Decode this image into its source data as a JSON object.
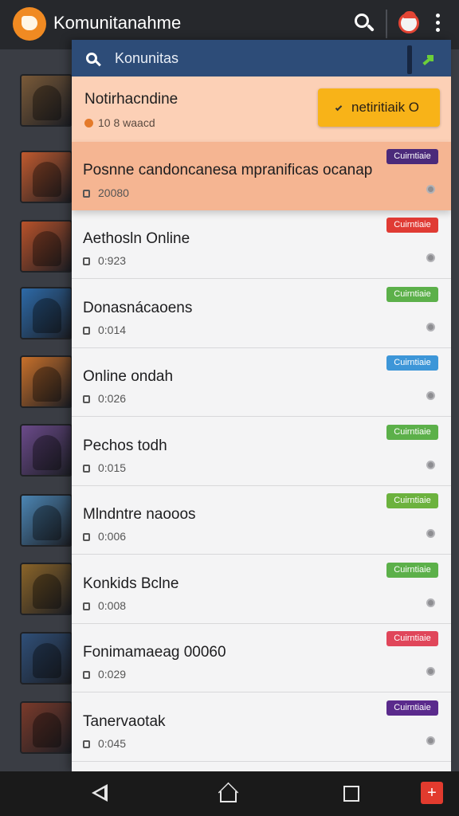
{
  "appbar": {
    "title": "Komunitanahme"
  },
  "panel": {
    "search_text": "Konunitas",
    "notification": {
      "title": "Notirhacndine",
      "meta": "10 8 waacd",
      "button_label": "netiritiaik O"
    },
    "featured": {
      "title": "Posnne candoncanesa mpranificas ocanap",
      "meta": "20080",
      "badge": "Cuirntiaie",
      "badge_color": "#4b2a7a"
    },
    "items": [
      {
        "title": "Aethosln Online",
        "meta": "0:923",
        "badge": "Cuirntiaie",
        "badge_color": "#e03b34"
      },
      {
        "title": "Donasnácaoens",
        "meta": "0:014",
        "badge": "Cuirntiaie",
        "badge_color": "#5cb04a"
      },
      {
        "title": "Online ondah",
        "meta": "0:026",
        "badge": "Cuirntiaie",
        "badge_color": "#3d96d8"
      },
      {
        "title": "Pechos todh",
        "meta": "0:015",
        "badge": "Cuirntiaie",
        "badge_color": "#5cb04a"
      },
      {
        "title": "Mlndntre naooos",
        "meta": "0:006",
        "badge": "Cuirntiaie",
        "badge_color": "#6cb23e"
      },
      {
        "title": "Konkids Bclne",
        "meta": "0:008",
        "badge": "Cuirntiaie",
        "badge_color": "#5cb04a"
      },
      {
        "title": "Fonimamaeag 00060",
        "meta": "0:029",
        "badge": "Cuirntiaie",
        "badge_color": "#e0465a"
      },
      {
        "title": "Tanervaotak",
        "meta": "0:045",
        "badge": "Cuirntiaie",
        "badge_color": "#5a2a8c"
      }
    ]
  },
  "side_thumbs": [
    {
      "color": "#7a5a38"
    },
    {
      "color": "#c05a2e"
    },
    {
      "color": "#b8522a"
    },
    {
      "color": "#2d6aa8"
    },
    {
      "color": "#c8702a"
    },
    {
      "color": "#6b4a8a"
    },
    {
      "color": "#4c86b4"
    },
    {
      "color": "#8a6428"
    },
    {
      "color": "#2f4f78"
    },
    {
      "color": "#7a3a2a"
    }
  ],
  "icons": {
    "app_logo": "app-logo-icon",
    "search": "search-icon",
    "profile": "avatar-icon",
    "menu": "kebab-menu-icon",
    "back": "back-icon",
    "home": "home-icon",
    "recents": "recents-icon",
    "add": "plus-icon"
  },
  "navbar": {
    "add_label": "+"
  }
}
